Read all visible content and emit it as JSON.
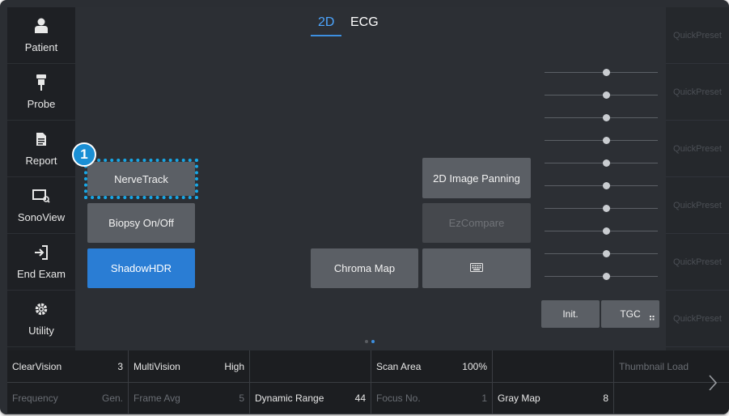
{
  "sidebar": {
    "items": [
      {
        "label": "Patient",
        "icon": "person-icon"
      },
      {
        "label": "Probe",
        "icon": "probe-icon"
      },
      {
        "label": "Report",
        "icon": "document-icon"
      },
      {
        "label": "SonoView",
        "icon": "sonoview-icon"
      },
      {
        "label": "End Exam",
        "icon": "exit-icon"
      },
      {
        "label": "Utility",
        "icon": "gear-icon"
      }
    ]
  },
  "tabs": [
    {
      "label": "2D",
      "active": true
    },
    {
      "label": "ECG",
      "active": false
    }
  ],
  "buttons": {
    "nervetrack": "NerveTrack",
    "biopsy": "Biopsy On/Off",
    "shadowhdr": "ShadowHDR",
    "chroma_map": "Chroma Map",
    "image_panning": "2D Image Panning",
    "ezcompare": "EzCompare",
    "keyboard_icon": "keyboard-icon",
    "init": "Init.",
    "tgc": "TGC"
  },
  "callout": {
    "number": "1"
  },
  "tgc_slider_count": 10,
  "quick_presets": [
    "QuickPreset",
    "QuickPreset",
    "QuickPreset",
    "QuickPreset",
    "QuickPreset",
    "QuickPreset"
  ],
  "params": {
    "row1": [
      {
        "label": "ClearVision",
        "value": "3"
      },
      {
        "label": "MultiVision",
        "value": "High"
      },
      {
        "label": "",
        "value": ""
      },
      {
        "label": "Scan Area",
        "value": "100%"
      },
      {
        "label": "",
        "value": ""
      },
      {
        "label": "Thumbnail Load",
        "value": ""
      }
    ],
    "row2": [
      {
        "label": "Frequency",
        "value": "Gen."
      },
      {
        "label": "Frame Avg",
        "value": "5"
      },
      {
        "label": "Dynamic Range",
        "value": "44"
      },
      {
        "label": "Focus No.",
        "value": "1"
      },
      {
        "label": "Gray Map",
        "value": "8"
      },
      {
        "label": "",
        "value": ""
      }
    ]
  },
  "colors": {
    "accent": "#2a7dd4",
    "focus_ring": "#18a7e6",
    "background": "#2c2f34"
  }
}
